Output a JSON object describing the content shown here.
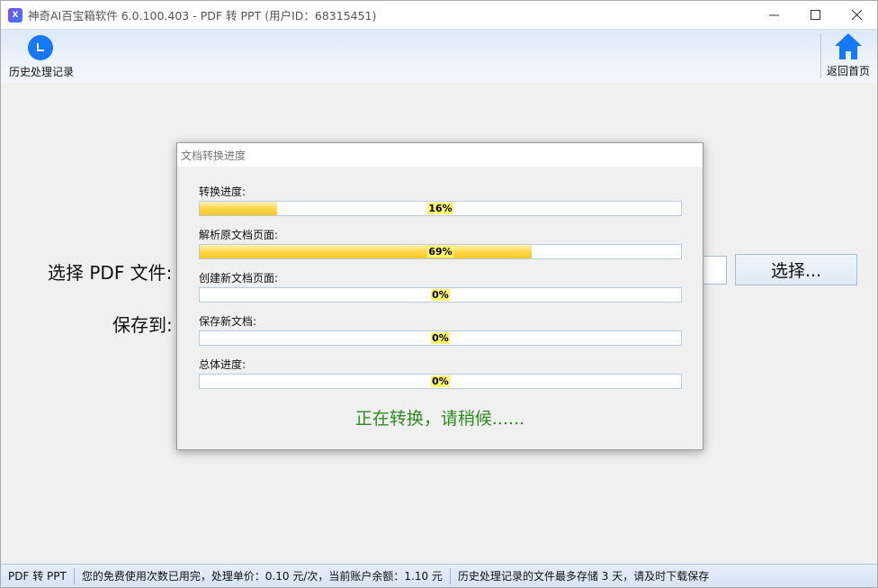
{
  "window": {
    "title": "神奇AI百宝箱软件 6.0.100.403 - PDF 转 PPT (用户ID：68315451)",
    "app_icon_glyph": "X",
    "controls": {
      "minimize": "—",
      "maximize": "☐",
      "close": "✕"
    }
  },
  "toolbar": {
    "history_label": "历史处理记录",
    "home_label": "返回首页",
    "accent_color": "#1677ff"
  },
  "form": {
    "select_pdf_label": "选择 PDF 文件:",
    "save_to_label": "保存到:",
    "select_button": "选择..."
  },
  "dialog": {
    "title": "文档转换进度",
    "progress": [
      {
        "label": "转换进度:",
        "value": 16,
        "text": "16%"
      },
      {
        "label": "解析原文档页面:",
        "value": 69,
        "text": "69%"
      },
      {
        "label": "创建新文档页面:",
        "value": 0,
        "text": "0%"
      },
      {
        "label": "保存新文档:",
        "value": 0,
        "text": "0%"
      },
      {
        "label": "总体进度:",
        "value": 0,
        "text": "0%"
      }
    ],
    "status_message": "正在转换，请稍候......",
    "status_color": "#2e8b22"
  },
  "statusbar": {
    "mode": "PDF 转 PPT",
    "usage": "您的免费使用次数已用完，处理单价：0.10 元/次，当前账户余额：1.10 元",
    "notice": "历史处理记录的文件最多存储 3 天，请及时下载保存"
  }
}
